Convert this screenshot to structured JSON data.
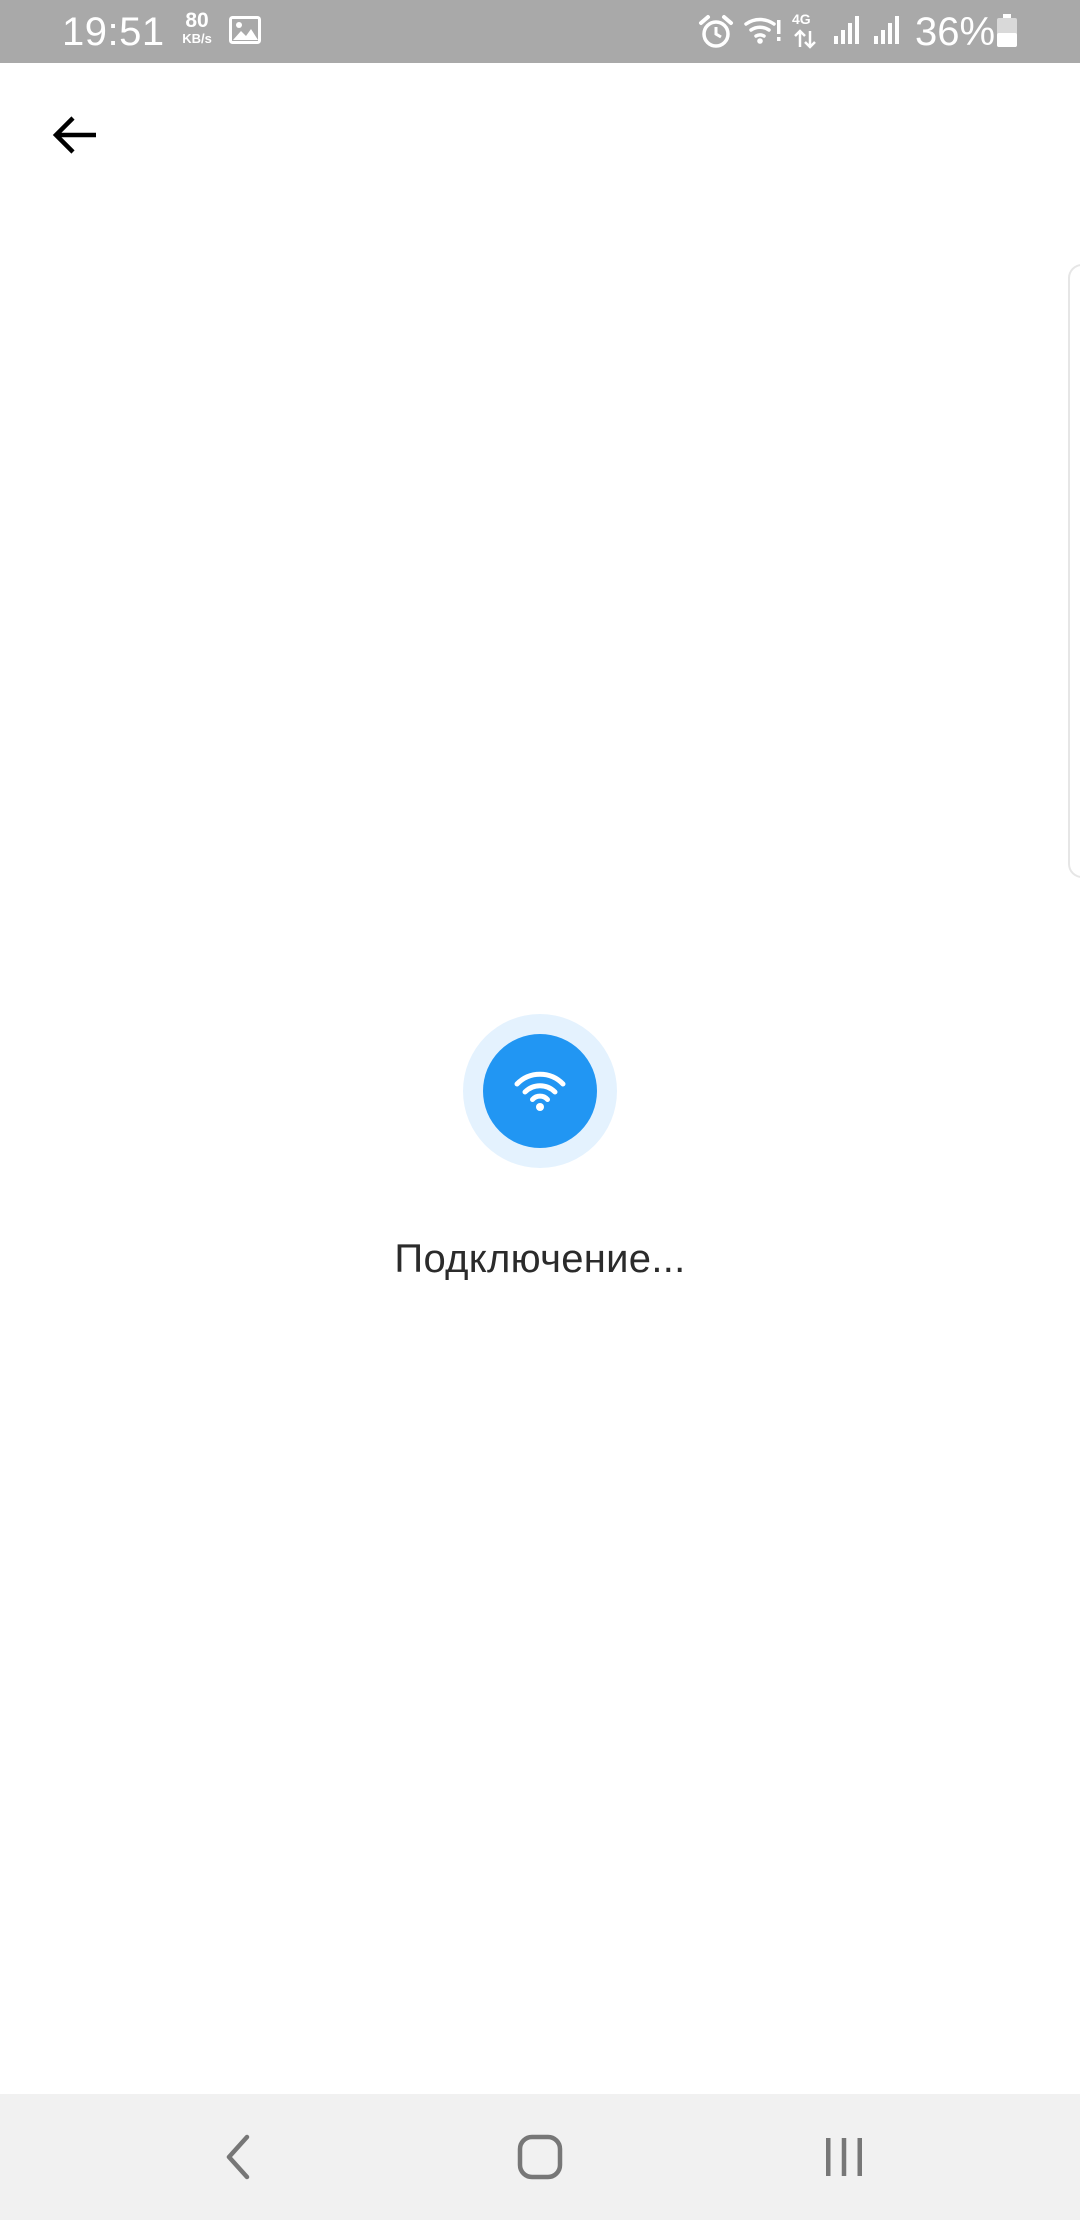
{
  "status_bar": {
    "time": "19:51",
    "net_speed_value": "80",
    "net_speed_unit": "KB/s",
    "network_type": "4G",
    "battery_percent": "36%",
    "icons": [
      "gallery-icon",
      "alarm-icon",
      "wifi-icon",
      "signal-icon",
      "signal-icon",
      "battery-icon"
    ]
  },
  "toolbar": {
    "back_icon": "arrow-left-icon"
  },
  "main": {
    "connect_icon": "wifi-icon",
    "status_text": "Подключение..."
  },
  "nav_bar": {
    "icons": [
      "chevron-left-icon",
      "home-icon",
      "recents-icon"
    ]
  },
  "colors": {
    "accent": "#2196f3",
    "accent_light": "#e4f2fe",
    "status_bar_bg": "#a9a9a9",
    "nav_bar_bg": "#f1f1f1"
  }
}
